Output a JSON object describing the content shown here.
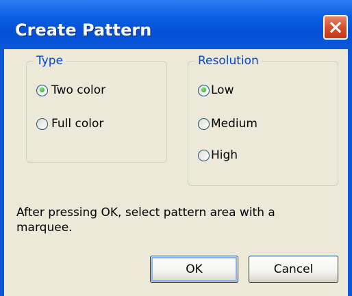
{
  "window": {
    "title": "Create Pattern"
  },
  "type_group": {
    "legend": "Type",
    "options": [
      {
        "label": "Two color",
        "selected": true
      },
      {
        "label": "Full color",
        "selected": false
      }
    ]
  },
  "resolution_group": {
    "legend": "Resolution",
    "options": [
      {
        "label": "Low",
        "selected": true
      },
      {
        "label": "Medium",
        "selected": false
      },
      {
        "label": "High",
        "selected": false
      }
    ]
  },
  "info_text": "After pressing OK, select pattern area with a marquee.",
  "buttons": {
    "ok": "OK",
    "cancel": "Cancel"
  },
  "icons": {
    "close": "close-icon",
    "radio_selected": "radio-selected-icon",
    "radio_unselected": "radio-unselected-icon"
  },
  "colors": {
    "title_bar": "#0a58d8",
    "dialog_background": "#ece9d8",
    "group_legend": "#0046d5",
    "close_button": "#d4502f"
  }
}
